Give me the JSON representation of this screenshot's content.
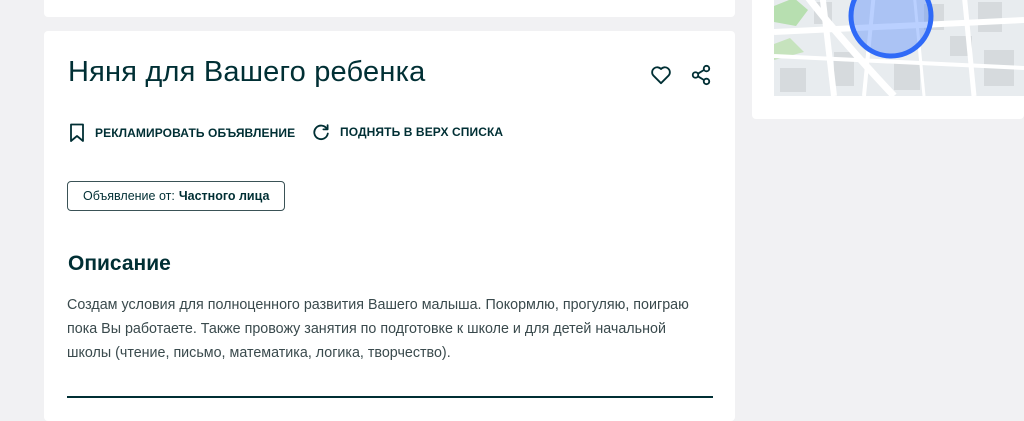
{
  "listing": {
    "title": "Няня для Вашего ребенка",
    "actions": {
      "promote_label": "РЕКЛАМИРОВАТЬ ОБЪЯВЛЕНИЕ",
      "raise_label": "ПОДНЯТЬ В ВЕРХ СПИСКА"
    },
    "seller": {
      "prefix": "Объявление от:",
      "type": "Частного лица"
    },
    "description": {
      "heading": "Описание",
      "text": "Создам условия для полноценного развития Вашего малыша. Покормлю, прогуляю, поиграю пока Вы работаете. Также провожу занятия по подготовке к школе и для детей начальной школы (чтение, письмо, математика, логика, творчество)."
    }
  },
  "icons": {
    "favorite": "heart-icon",
    "share": "share-icon",
    "promote": "bookmark-icon",
    "raise": "refresh-icon"
  },
  "colors": {
    "text_primary": "#002f34",
    "page_background": "#f1f1f3",
    "map_location_circle": "#3a77ff"
  }
}
